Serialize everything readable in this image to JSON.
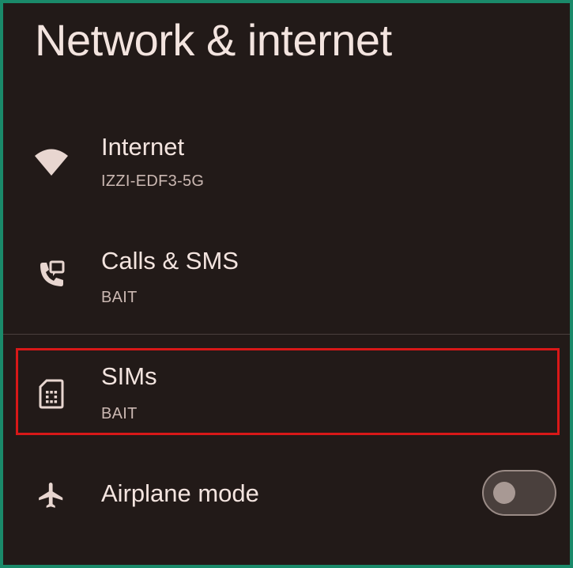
{
  "header": {
    "title": "Network & internet"
  },
  "items": [
    {
      "title": "Internet",
      "subtitle": "IZZI-EDF3-5G",
      "icon": "wifi-icon"
    },
    {
      "title": "Calls & SMS",
      "subtitle": "BAIT",
      "icon": "calls-sms-icon"
    },
    {
      "title": "SIMs",
      "subtitle": "BAIT",
      "icon": "sim-card-icon"
    },
    {
      "title": "Airplane mode",
      "icon": "airplane-icon",
      "toggle": {
        "on": false
      }
    }
  ],
  "colors": {
    "background": "#221a18",
    "text": "#f3e4df",
    "subtext": "#cbb8b2",
    "highlight": "#d81818",
    "frame": "#1a8a6a"
  }
}
